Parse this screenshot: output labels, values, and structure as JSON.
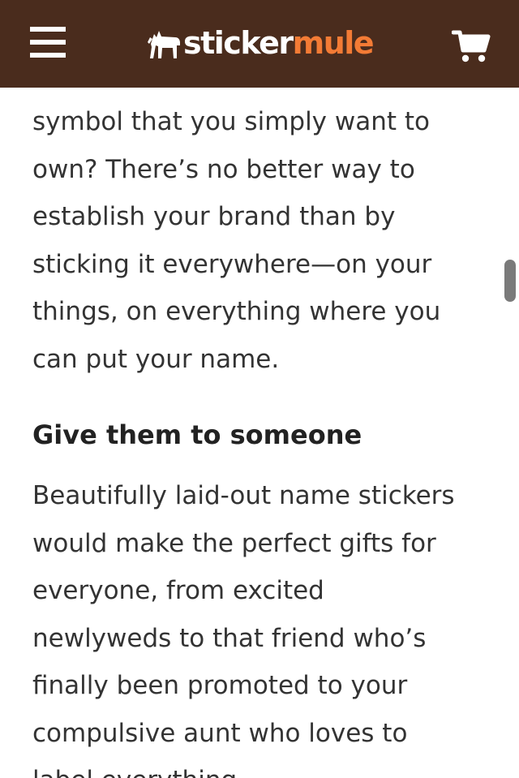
{
  "header": {
    "logo_word_1": "sticker",
    "logo_word_2": "mule",
    "colors": {
      "bar": "#4a2c1d",
      "accent": "#f37b35",
      "text": "#ffffff"
    }
  },
  "article": {
    "partial_line": "mbol that you simply want to own? There's no",
    "paragraph_1": [
      "symbol that you simply want to",
      "own? There’s no better way to",
      "establish your brand than by",
      "sticking it everywhere—on your",
      "things, on everything where you",
      "can put your name."
    ],
    "heading": "Give them to someone",
    "paragraph_2": [
      "Beautifully laid-out name stickers",
      "would make the perfect gifts for",
      "everyone, from excited",
      "newlyweds to that friend who’s",
      "finally been promoted to your",
      "compulsive aunt who loves to",
      "label everything."
    ]
  },
  "icons": {
    "menu": "hamburger-menu-icon",
    "logo": "mule-logo-icon",
    "cart": "shopping-cart-icon"
  }
}
